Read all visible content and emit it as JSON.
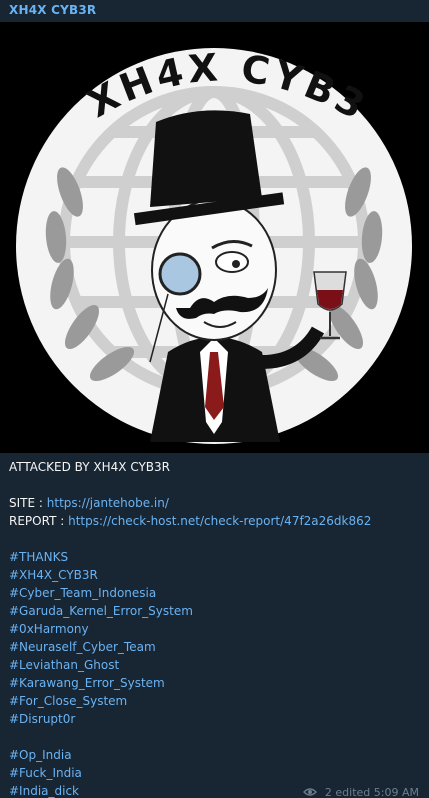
{
  "channel": {
    "name": "XH4X CYB3R"
  },
  "image": {
    "logo_text": "XH4X CYB3R"
  },
  "message": {
    "headline": "ATTACKED BY XH4X CYB3R",
    "site_label": "SITE :",
    "site_url": "https://jantehobe.in/",
    "report_label": "REPORT :",
    "report_url": "https://check-host.net/check-report/47f2a26dk862",
    "hashtags_group1": [
      "#THANKS",
      "#XH4X_CYB3R",
      "#Cyber_Team_Indonesia",
      "#Garuda_Kernel_Error_System",
      "#0xHarmony",
      "#Neuraself_Cyber_Team",
      "#Leviathan_Ghost",
      "#Karawang_Error_System",
      "#For_Close_System",
      "#Disrupt0r"
    ],
    "hashtags_group2": [
      "#Op_India",
      "#Fuck_India",
      "#India_dick"
    ]
  },
  "footer": {
    "views": "2",
    "edited_time": "edited 5:09 AM"
  }
}
